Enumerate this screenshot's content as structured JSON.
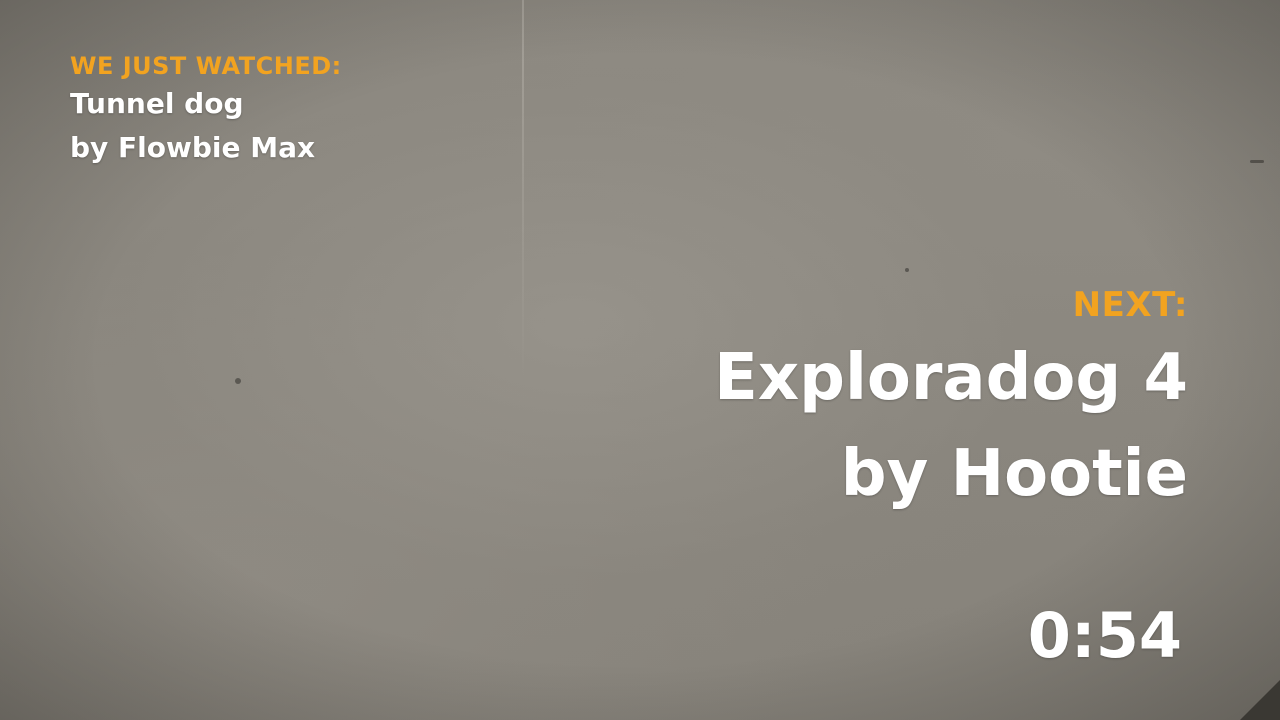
{
  "previous": {
    "heading": "WE JUST WATCHED:",
    "title": "Tunnel dog",
    "author": "by Flowbie Max"
  },
  "next": {
    "heading": "NEXT:",
    "title": "Exploradog 4",
    "author": "by Hootie"
  },
  "countdown": "0:54",
  "colors": {
    "accent": "#f2a320",
    "text": "#ffffff",
    "background": "#8b877f"
  }
}
